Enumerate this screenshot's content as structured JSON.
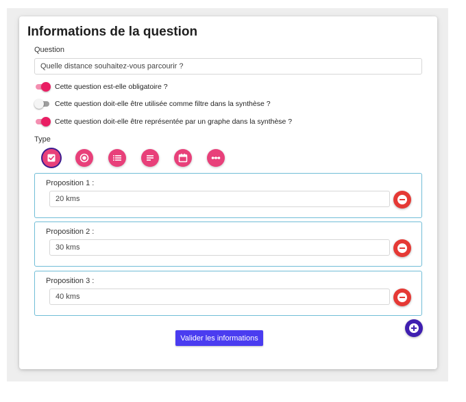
{
  "form": {
    "title": "Informations de la question",
    "question_label": "Question",
    "question_value": "Quelle distance souhaitez-vous parcourir ?",
    "toggles": [
      {
        "label": "Cette question est-elle obligatoire ?",
        "on": true
      },
      {
        "label": "Cette question doit-elle être utilisée comme filtre dans la synthèse ?",
        "on": false
      },
      {
        "label": "Cette question doit-elle être représentée par un graphe dans la synthèse ?",
        "on": true
      }
    ],
    "type_label": "Type",
    "type_icons": [
      "checkbox-icon",
      "radio-icon",
      "list-icon",
      "text-lines-icon",
      "calendar-icon",
      "range-icon"
    ],
    "selected_type": "checkbox-icon",
    "propositions": [
      {
        "label": "Proposition 1 :",
        "value": "20 kms"
      },
      {
        "label": "Proposition 2 :",
        "value": "30 kms"
      },
      {
        "label": "Proposition 3 :",
        "value": "40 kms"
      }
    ],
    "submit_label": "Valider les informations"
  },
  "colors": {
    "accent_pink": "#e8407a",
    "remove_red": "#e53935",
    "add_purple": "#3f1fb0",
    "submit_blue": "#4a3cf0",
    "proposition_border": "#6fbcd6"
  }
}
